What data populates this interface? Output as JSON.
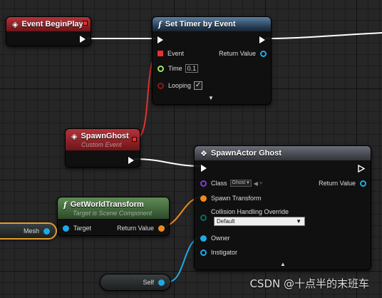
{
  "colors": {
    "exec": "#ffffff",
    "delegate_red": "#e53030",
    "struct_orange": "#f08a20",
    "object_blue": "#1fa9e6",
    "float_green": "#9be866",
    "class_purple": "#7d3fd0",
    "bool_red": "#8a1a1a"
  },
  "event_begin_play": {
    "title": "Event BeginPlay"
  },
  "set_timer": {
    "title": "Set Timer by Event",
    "pins": {
      "event": "Event",
      "time": "Time",
      "time_value": "0.1",
      "looping": "Looping",
      "return_value": "Return Value"
    }
  },
  "spawn_ghost": {
    "title": "SpawnGhost",
    "subtitle": "Custom Event"
  },
  "spawn_actor": {
    "title": "SpawnActor Ghost",
    "pins": {
      "class": "Class",
      "class_value": "Ghost",
      "spawn_transform": "Spawn Transform",
      "collision": "Collision Handling Override",
      "collision_value": "Default",
      "owner": "Owner",
      "instigator": "Instigator",
      "return_value": "Return Value"
    }
  },
  "get_world_transform": {
    "title": "GetWorldTransform",
    "subtitle": "Target is Scene Component",
    "pins": {
      "target": "Target",
      "return_value": "Return Value"
    }
  },
  "mesh_var": {
    "label": "Mesh"
  },
  "self_var": {
    "label": "Self"
  },
  "icons": {
    "event": "diamond-event-icon",
    "function": "function-f-icon",
    "spawn": "spawn-actor-icon"
  },
  "watermark": "CSDN @十点半的末班车"
}
